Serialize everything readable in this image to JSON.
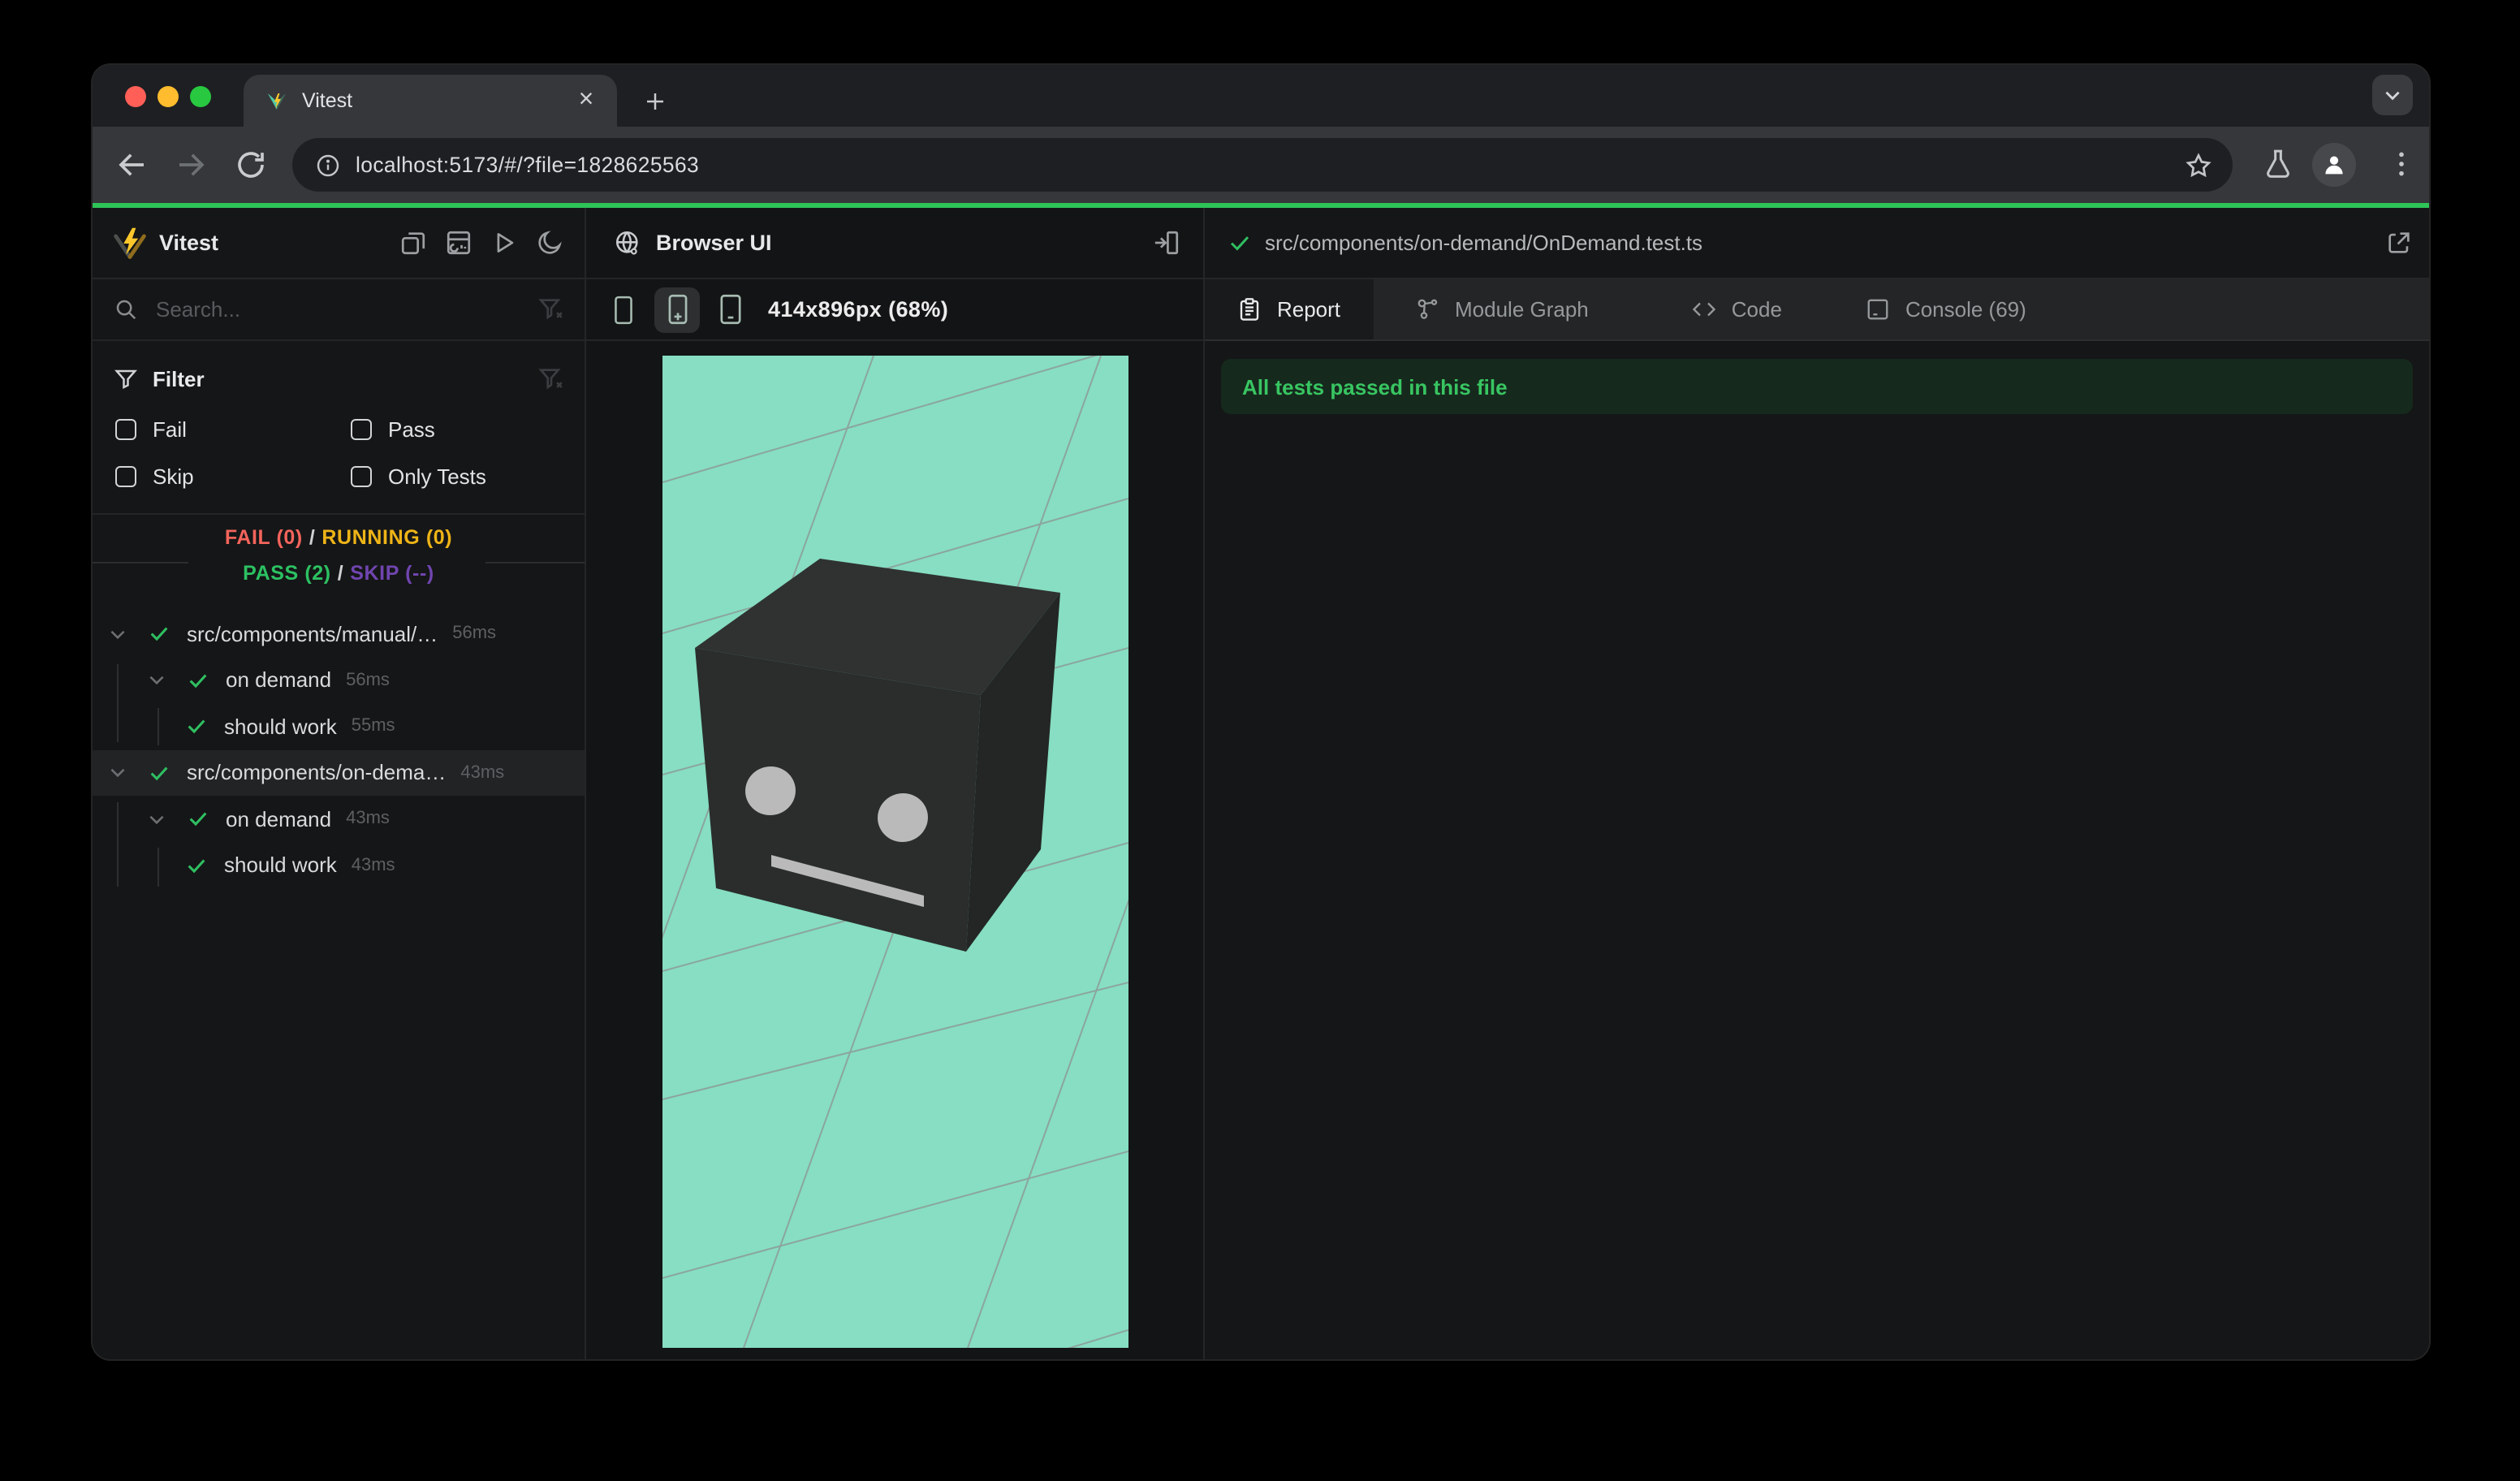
{
  "browser": {
    "tab_title": "Vitest",
    "url": "localhost:5173/#/?file=1828625563"
  },
  "sidebar": {
    "title": "Vitest",
    "search_placeholder": "Search...",
    "filter": {
      "title": "Filter",
      "options": [
        "Fail",
        "Pass",
        "Skip",
        "Only Tests"
      ]
    },
    "summary": {
      "fail": "FAIL (0)",
      "running": "RUNNING (0)",
      "pass": "PASS (2)",
      "skip": "SKIP (--)",
      "sep": "/"
    },
    "tree": [
      {
        "label": "src/components/manual/…",
        "duration": "56ms",
        "depth": 0
      },
      {
        "label": "on demand",
        "duration": "56ms",
        "depth": 1
      },
      {
        "label": "should work",
        "duration": "55ms",
        "depth": 2
      },
      {
        "label": "src/components/on-dema…",
        "duration": "43ms",
        "depth": 0,
        "selected": true
      },
      {
        "label": "on demand",
        "duration": "43ms",
        "depth": 1
      },
      {
        "label": "should work",
        "duration": "43ms",
        "depth": 2
      }
    ]
  },
  "browser_panel": {
    "title": "Browser UI",
    "viewport_label": "414x896px (68%)"
  },
  "report_panel": {
    "file_path": "src/components/on-demand/OnDemand.test.ts",
    "tabs": [
      {
        "label": "Report",
        "active": true
      },
      {
        "label": "Module Graph",
        "active": false
      },
      {
        "label": "Code",
        "active": false
      },
      {
        "label": "Console (69)",
        "active": false
      }
    ],
    "banner": "All tests passed in this file"
  },
  "glyphs": {
    "close": "×",
    "new_tab": "+"
  },
  "colors": {
    "fail": "#f4645c",
    "running": "#eeb417",
    "pass": "#2cc162",
    "skip": "#7045af",
    "progress_bar": "#2ec458",
    "banner_bg": "#16291d",
    "banner_text": "#38c561",
    "viewport_bg": "#87dec2",
    "vitest_yellow": "#fcc72b",
    "traffic_red": "#ff5f57",
    "traffic_yellow": "#febc2e",
    "traffic_green": "#28c840"
  }
}
